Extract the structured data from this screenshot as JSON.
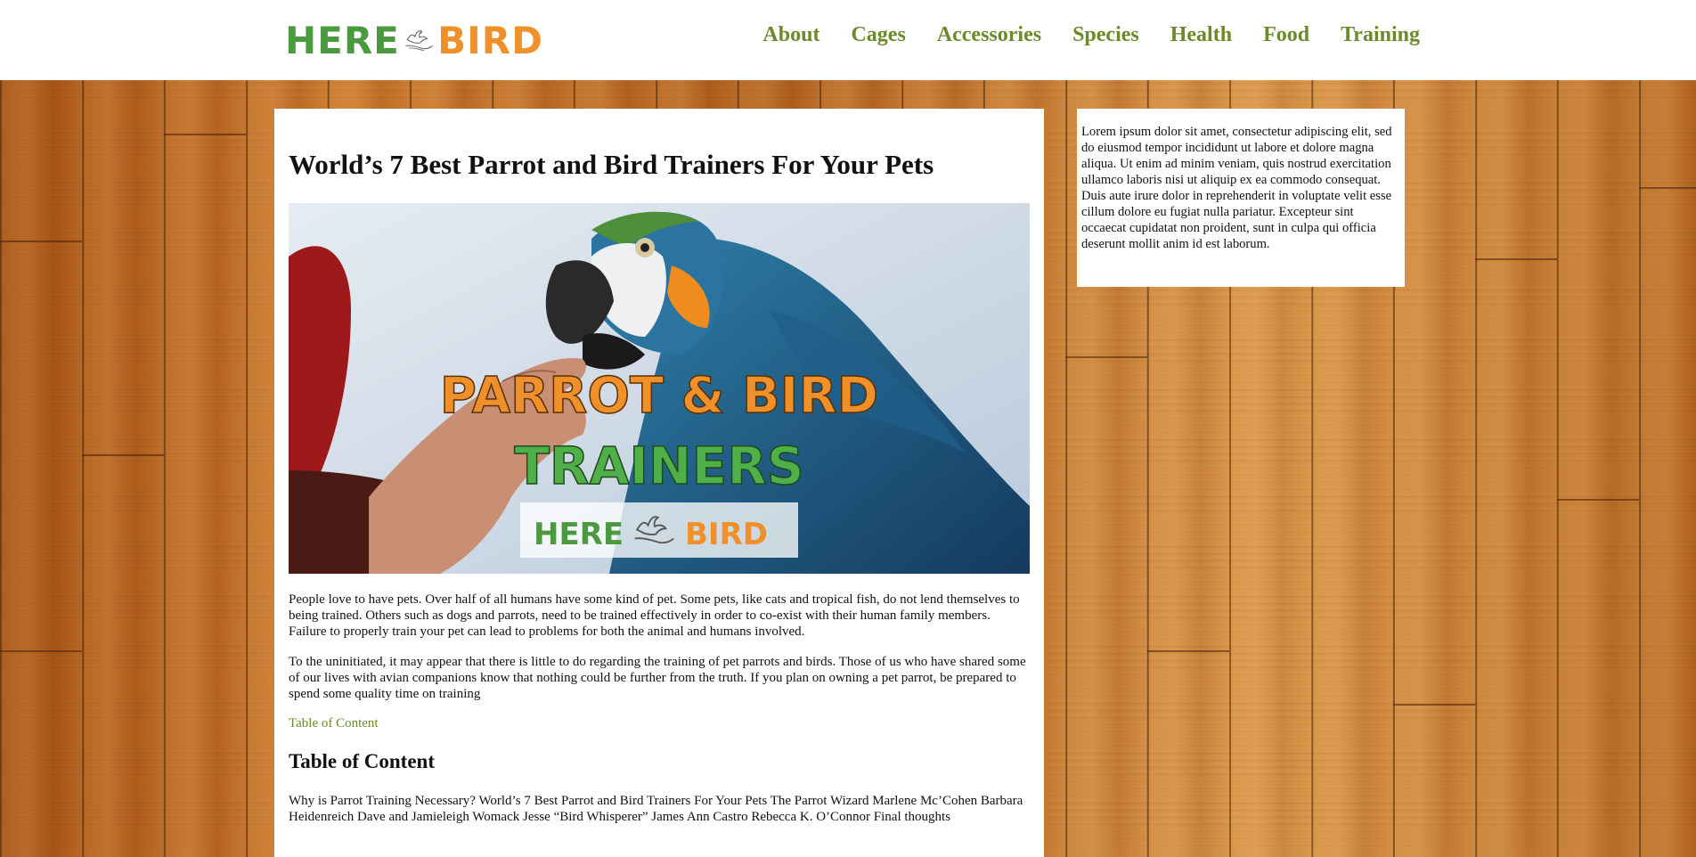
{
  "logo": {
    "here": "HERE",
    "bird": "BIRD"
  },
  "nav": {
    "items": [
      "About",
      "Cages",
      "Accessories",
      "Species",
      "Health",
      "Food",
      "Training"
    ]
  },
  "article": {
    "title": "World’s 7 Best Parrot and Bird Trainers For Your Pets",
    "hero": {
      "line1": "PARROT & BIRD",
      "line2": "TRAINERS",
      "badge_here": "HERE",
      "badge_bird": "BIRD"
    },
    "paragraphs": [
      "People love to have pets. Over half of all humans have some kind of pet. Some pets, like cats and tropical fish, do not lend themselves to being trained. Others such as dogs and parrots, need to be trained effectively in order to co-exist with their human family members. Failure to properly train your pet can lead to problems for both the animal and humans involved.",
      "To the uninitiated, it may appear that there is little to do regarding the training of pet parrots and birds. Those of us who have shared some of our lives with avian companions know that nothing could be further from the truth. If you plan on owning a pet parrot, be prepared to spend some quality time on training"
    ],
    "toc_link": "Table of Content",
    "toc_heading": "Table of Content",
    "toc_text": "Why is Parrot Training Necessary? World’s 7 Best Parrot and Bird Trainers For Your Pets The Parrot Wizard Marlene Mc’Cohen Barbara Heidenreich Dave and Jamieleigh Womack Jesse “Bird Whisperer” James Ann Castro Rebecca K. O’Connor Final thoughts"
  },
  "sidebar": {
    "text": "Lorem ipsum dolor sit amet, consectetur adipiscing elit, sed do eiusmod tempor incididunt ut labore et dolore magna aliqua. Ut enim ad minim veniam, quis nostrud exercitation ullamco laboris nisi ut aliquip ex ea commodo consequat. Duis aute irure dolor in reprehenderit in voluptate velit esse cillum dolore eu fugiat nulla pariatur. Excepteur sint occaecat cupidatat non proident, sunt in culpa qui officia deserunt mollit anim id est laborum."
  },
  "colors": {
    "brand_green": "#4c9a40",
    "brand_orange": "#f0902a",
    "nav_green": "#6b8a2a",
    "wood": "#b8651e"
  },
  "icons": [
    "bird-hand-logo-icon"
  ]
}
